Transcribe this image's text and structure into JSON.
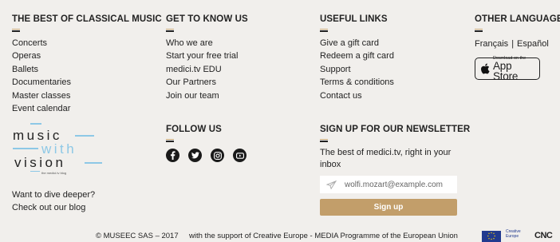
{
  "col1": {
    "heading": "THE BEST OF CLASSICAL MUSIC",
    "links": [
      "Concerts",
      "Operas",
      "Ballets",
      "Documentaries",
      "Master classes",
      "Event calendar"
    ]
  },
  "col2": {
    "heading": "GET TO KNOW US",
    "links": [
      "Who we are",
      "Start your free trial",
      "medici.tv EDU",
      "Our Partners",
      "Join our team"
    ]
  },
  "col3": {
    "heading": "USEFUL LINKS",
    "links": [
      "Give a gift card",
      "Redeem a gift card",
      "Support",
      "Terms & conditions",
      "Contact us"
    ]
  },
  "col4": {
    "heading": "OTHER LANGUAGES",
    "languages": [
      "Français",
      "Español"
    ],
    "separator": "|"
  },
  "app_store": {
    "small_text": "Download on the",
    "big_text": "App Store"
  },
  "logo": {
    "word1": "music",
    "word2": "with",
    "word3": "vision",
    "tagline": "the medici.tv blog",
    "accent_color": "#8dc8e6"
  },
  "blog": {
    "line1": "Want to dive deeper?",
    "line2": "Check out our blog"
  },
  "follow": {
    "heading": "FOLLOW US",
    "icons": [
      "facebook-icon",
      "twitter-icon",
      "instagram-icon",
      "youtube-icon"
    ]
  },
  "newsletter": {
    "heading": "SIGN UP FOR OUR NEWSLETTER",
    "text": "The best of medici.tv, right in your inbox",
    "placeholder": "wolfi.mozart@example.com",
    "button": "Sign up",
    "button_color": "#c29e6a"
  },
  "footer": {
    "copyright": "© MUSEEC SAS – 2017",
    "support": "with the support of Creative Europe - MEDIA Programme of the European Union",
    "creative_europe_line1": "Creative",
    "creative_europe_line2": "Europe",
    "cnc": "CNC"
  }
}
